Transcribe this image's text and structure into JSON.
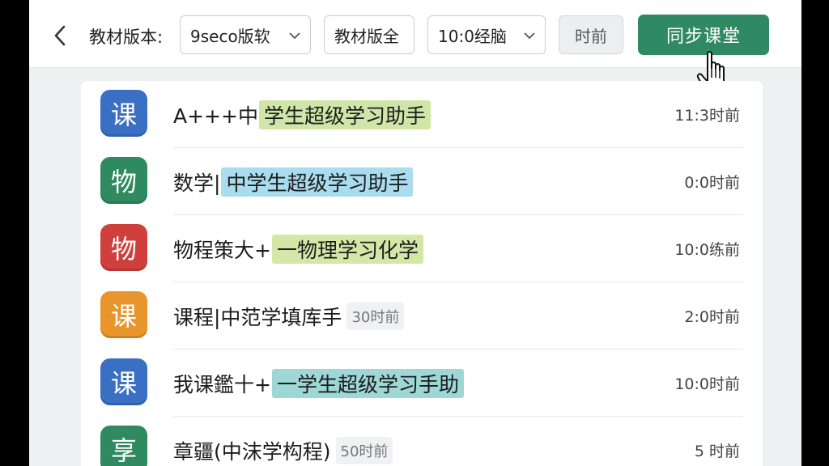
{
  "toolbar": {
    "back_icon": "chevron-left-icon",
    "label": "教材版本:",
    "select_version": "9seco版软",
    "select_textbook": "教材版全",
    "select_time": "10:0经脑",
    "time_button": "时前",
    "sync_button": "同步课堂",
    "accent": "#2f8a63"
  },
  "rows": [
    {
      "badge": "课",
      "color": "#3a6fc4",
      "pre": "A+++中",
      "hl": "学生超级学习助手",
      "hl_color": "#cfe6a8",
      "sub": "",
      "time": "11:3时前"
    },
    {
      "badge": "物",
      "color": "#2f8a5f",
      "pre": "数学|",
      "hl": "中学生超级学习助手",
      "hl_color": "#a9dcef",
      "sub": "",
      "time": "0:0时前"
    },
    {
      "badge": "物",
      "color": "#cf3f3c",
      "pre": "物程策大+",
      "hl": "一物理学习化学",
      "hl_color": "#d3e8a6",
      "sub": "",
      "time": "10:0练前"
    },
    {
      "badge": "课",
      "color": "#e8952c",
      "pre": "课程|中范学填库手",
      "hl": "",
      "hl_color": "",
      "sub": "30时前",
      "time": "2:0时前"
    },
    {
      "badge": "课",
      "color": "#3a6fc4",
      "pre": "我课鑑十+",
      "hl": "一学生超级学习手助",
      "hl_color": "#9fd7d6",
      "sub": "",
      "time": "10:0时前"
    },
    {
      "badge": "享",
      "color": "#2f8a5f",
      "pre": "章疆(中沫学构程)",
      "hl": "",
      "hl_color": "",
      "sub": "50时前",
      "time": "5 时前"
    }
  ]
}
